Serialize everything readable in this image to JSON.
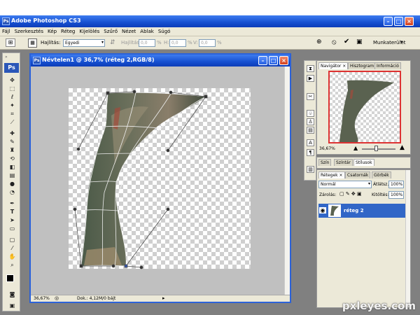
{
  "app": {
    "title": "Adobe Photoshop CS3",
    "icon_text": "Ps"
  },
  "menu": [
    "Fájl",
    "Szerkesztés",
    "Kép",
    "Réteg",
    "Kijelölés",
    "Szűrő",
    "Nézet",
    "Ablak",
    "Súgó"
  ],
  "options": {
    "warp_label": "Hajlítás:",
    "warp_value": "Egyedi",
    "bend_label": "Hajlítás:",
    "bend_value": "0,0",
    "bend_unit": "%",
    "h_label": "H:",
    "h_value": "0,0",
    "h_unit": "%",
    "v_label": "V:",
    "v_value": "0,0",
    "v_unit": "%",
    "workspace_label": "Munkaterület"
  },
  "document": {
    "title": "Névtelen1 @ 36,7% (réteg 2,RGB/8)",
    "zoom": "36,67%",
    "doc_info": "Dok.: 4,12M/0 bájt"
  },
  "panels": {
    "navigator_tabs": [
      "Navigátor",
      "Hisztogram",
      "Információ"
    ],
    "navigator_zoom": "36,67%",
    "color_tabs": [
      "Szín",
      "Színtár",
      "Stílusok"
    ],
    "layer_tabs": [
      "Rétegek",
      "Csatornák",
      "Görbék"
    ],
    "blend_mode": "Normál",
    "opacity_label": "Átlátsz.:",
    "opacity_value": "100%",
    "lock_label": "Zárolás:",
    "fill_label": "Kitöltés:",
    "fill_value": "100%",
    "layer_name": "réteg 2"
  },
  "watermark": "pxleyes.com",
  "colors": {
    "xp_blue": "#1650d0",
    "selection": "#3166c7"
  }
}
